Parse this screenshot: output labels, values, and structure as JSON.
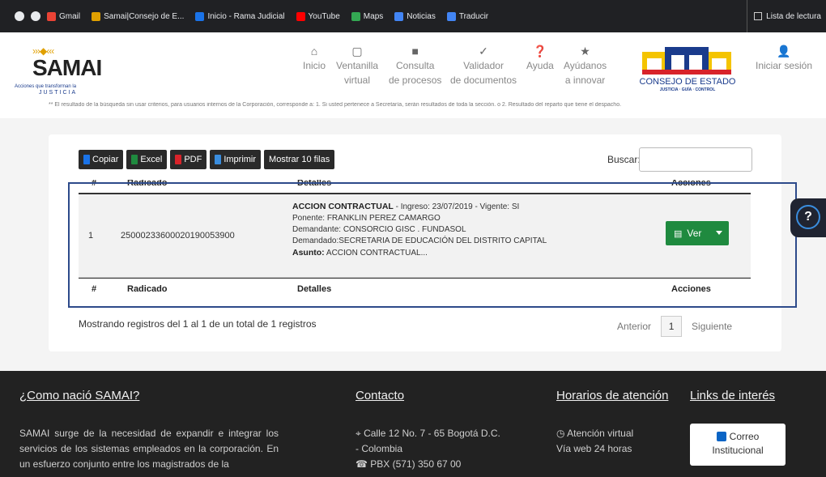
{
  "bookmarks": {
    "items": [
      {
        "label": "Gmail",
        "icon": "gmail-icon",
        "color": "#ea4335"
      },
      {
        "label": "Samai|Consejo de E...",
        "icon": "samai-icon",
        "color": "#e0a000"
      },
      {
        "label": "Inicio - Rama Judicial",
        "icon": "rama-icon",
        "color": "#1a73e8"
      },
      {
        "label": "YouTube",
        "icon": "youtube-icon",
        "color": "#ff0000"
      },
      {
        "label": "Maps",
        "icon": "maps-icon",
        "color": "#34a853"
      },
      {
        "label": "Noticias",
        "icon": "news-icon",
        "color": "#4285f4"
      },
      {
        "label": "Traducir",
        "icon": "translate-icon",
        "color": "#4285f4"
      }
    ],
    "reading_list": "Lista de lectura"
  },
  "header": {
    "logo_word": "SAMAI",
    "logo_tagline": "Acciones que transforman la",
    "logo_sub": "JUSTICIA",
    "nav": [
      {
        "line1": "Inicio",
        "line2": "",
        "icon": "home-icon"
      },
      {
        "line1": "Ventanilla",
        "line2": "virtual",
        "icon": "window-icon"
      },
      {
        "line1": "Consulta",
        "line2": "de procesos",
        "icon": "folder-icon"
      },
      {
        "line1": "Validador",
        "line2": "de documentos",
        "icon": "validate-icon"
      },
      {
        "line1": "Ayuda",
        "line2": "",
        "icon": "help-icon"
      },
      {
        "line1": "Ayúdanos",
        "line2": "a innovar",
        "icon": "star-icon"
      }
    ],
    "cde_name": "CONSEJO DE ESTADO",
    "cde_sub": "JUSTICIA · GUÍA · CONTROL",
    "login": "Iniciar sesión"
  },
  "notice": "** El resultado de la búsqueda sin usar criterios, para usuarios internos de la Corporación, corresponde a: 1. Si usted pertenece a Secretaría, serán resultados de toda la sección. o 2. Resultado del reparto que tiene el despacho.",
  "toolbar": {
    "copy": "Copiar",
    "excel": "Excel",
    "pdf": "PDF",
    "print": "Imprimir",
    "show": "Mostrar 10 filas",
    "search_label": "Buscar:"
  },
  "table": {
    "headers": {
      "num": "#",
      "radicado": "Radicado",
      "detalles": "Detalles",
      "acciones": "Acciones"
    },
    "row": {
      "num": "1",
      "radicado": "25000233600020190053900",
      "title": "ACCION CONTRACTUAL",
      "ingreso": " - Ingreso: 23/07/2019 - Vigente: SI",
      "ponente": "Ponente: FRANKLIN PEREZ CAMARGO",
      "demandante": "Demandante: CONSORCIO GISC . FUNDASOL",
      "demandado": "Demandado:SECRETARIA DE EDUCACIÓN DEL DISTRITO CAPITAL",
      "asunto_label": "Asunto:",
      "asunto": " ACCION CONTRACTUAL...",
      "action": "Ver"
    }
  },
  "pagination": {
    "summary": "Mostrando registros del 1 al 1 de un total de 1 registros",
    "prev": "Anterior",
    "page": "1",
    "next": "Siguiente"
  },
  "help_symbol": "?",
  "footer": {
    "about_title": "¿Como nació SAMAI?",
    "about_text": "SAMAI surge de la necesidad de expandir e integrar los servicios de los sistemas empleados en la corporación. En un esfuerzo conjunto entre los magistrados de la",
    "contact_title": "Contacto",
    "address": "Calle 12 No. 7 - 65 Bogotá D.C. - Colombia",
    "phone": "PBX (571) 350 67 00",
    "hours_title": "Horarios de atención",
    "hours_line1": "Atención virtual",
    "hours_line2": "Vía web 24 horas",
    "links_title": "Links de interés",
    "mail_line1": "Correo",
    "mail_line2": "Institucional"
  },
  "colors": {
    "accent_green": "#1f8a3f",
    "brand_blue": "#1a3b8c",
    "highlight_box": "#2d4a8a"
  }
}
